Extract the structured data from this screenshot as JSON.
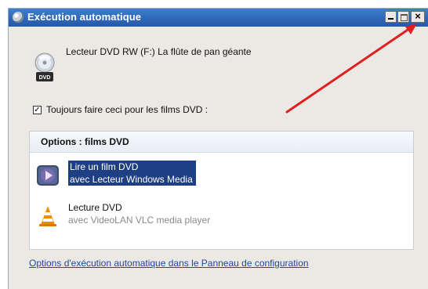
{
  "window": {
    "title": "Exécution automatique"
  },
  "device": {
    "label": "Lecteur DVD RW (F:) La flûte de pan géante",
    "icon": "dvd-drive-icon"
  },
  "checkbox": {
    "checked": true,
    "mark": "✓",
    "label": "Toujours faire ceci pour les films DVD :"
  },
  "options": {
    "header": "Options : films DVD",
    "items": [
      {
        "main": "Lire un film DVD",
        "sub": "avec Lecteur Windows Media",
        "icon": "windows-media-player-icon",
        "selected": true
      },
      {
        "main": "Lecture DVD",
        "sub": "avec VideoLAN VLC media player",
        "icon": "vlc-cone-icon",
        "selected": false
      }
    ]
  },
  "footer": {
    "link": "Options d'exécution automatique dans le Panneau de configuration"
  },
  "annotation": {
    "color": "#e02020"
  }
}
